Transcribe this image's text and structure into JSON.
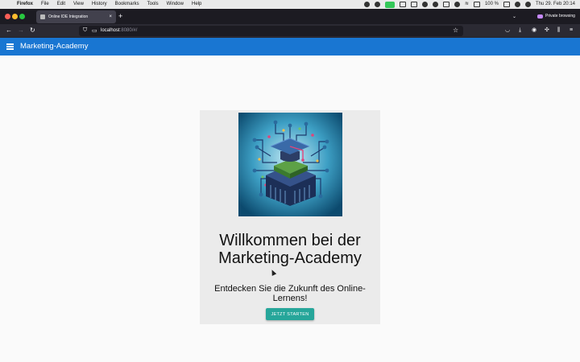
{
  "menubar": {
    "app": "Firefox",
    "items": [
      "File",
      "Edit",
      "View",
      "History",
      "Bookmarks",
      "Tools",
      "Window",
      "Help"
    ],
    "battery": "100 %",
    "clock": "Thu 29. Feb 20:14"
  },
  "browser": {
    "tab_title": "Online IDE Integration",
    "private_label": "Private browsing",
    "url_host": "localhost",
    "url_path": ":8080/#/"
  },
  "app": {
    "title": "Marketing-Academy"
  },
  "hero": {
    "headline_line1": "Willkommen bei der",
    "headline_line2": "Marketing-Academy",
    "subtitle": "Entdecken Sie die Zukunft des Online-Lernens!",
    "cta_label": "JETZT STARTEN",
    "image_icon": "graduation-cap-chip-icon"
  },
  "colors": {
    "app_bar": "#1976d2",
    "cta": "#26a69a"
  }
}
